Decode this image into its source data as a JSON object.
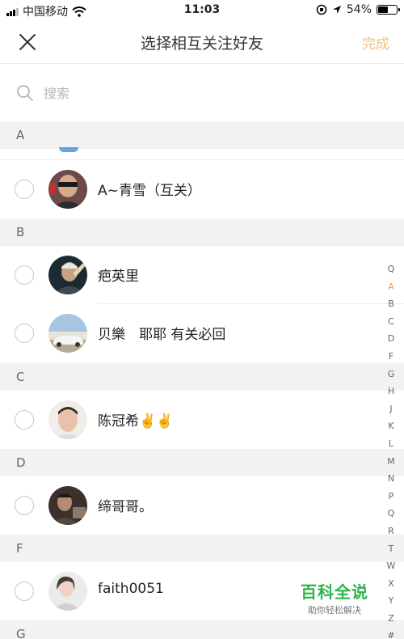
{
  "status_bar": {
    "carrier": "中国移动",
    "time": "11:03",
    "battery": "54%",
    "battery_level": 0.54
  },
  "navbar": {
    "title": "选择相互关注好友",
    "done_label": "完成",
    "colors": {
      "done": "#f3c183"
    }
  },
  "search": {
    "placeholder": "搜索"
  },
  "sections": [
    {
      "letter": "A",
      "contacts": [
        {
          "name": "A~青雪（互关）"
        }
      ]
    },
    {
      "letter": "B",
      "contacts": [
        {
          "name": "疤英里"
        },
        {
          "name": "贝樂　耶耶 有关必回"
        }
      ]
    },
    {
      "letter": "C",
      "contacts": [
        {
          "name": "陈冠希✌️✌️"
        }
      ]
    },
    {
      "letter": "D",
      "contacts": [
        {
          "name": "缔哥哥。"
        }
      ]
    },
    {
      "letter": "F",
      "contacts": [
        {
          "name": "faith0051"
        }
      ]
    },
    {
      "letter": "G",
      "contacts": []
    }
  ],
  "index_bar": {
    "search_symbol": "Q",
    "letters": [
      "A",
      "B",
      "C",
      "D",
      "F",
      "G",
      "H",
      "J",
      "K",
      "L",
      "M",
      "N",
      "P",
      "Q",
      "R",
      "T",
      "W",
      "X",
      "Y",
      "Z",
      "#"
    ],
    "active": "A",
    "active_color": "#f29b3b"
  },
  "watermark": {
    "title": "百科全说",
    "subtitle": "助你轻松解决"
  }
}
